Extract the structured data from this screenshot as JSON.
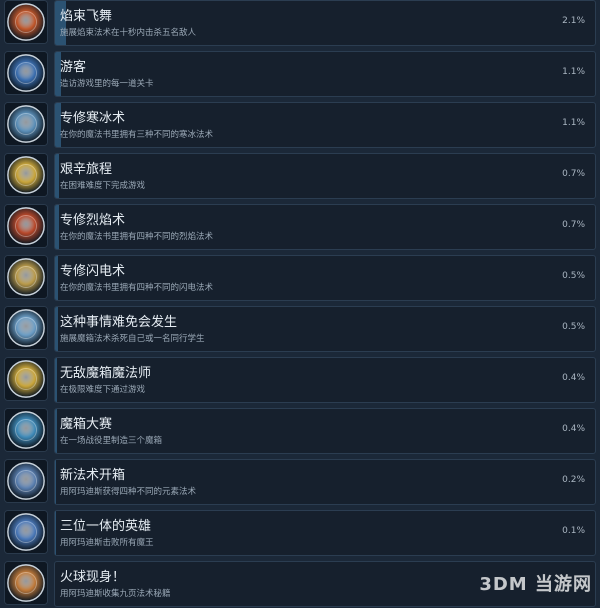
{
  "achievements": [
    {
      "title": "焰束飞舞",
      "desc": "施展焰束法术在十秒内击杀五名敌人",
      "percent_label": "2.1%",
      "percent": 2.1,
      "icon": "flame-streak-icon",
      "color": "#c0562a"
    },
    {
      "title": "游客",
      "desc": "造访游戏里的每一道关卡",
      "percent_label": "1.1%",
      "percent": 1.1,
      "icon": "globe-icon",
      "color": "#3c6fb0"
    },
    {
      "title": "专修寒冰术",
      "desc": "在你的魔法书里拥有三种不同的寒冰法术",
      "percent_label": "1.1%",
      "percent": 1.1,
      "icon": "ice-book-icon",
      "color": "#5b8fb8"
    },
    {
      "title": "艰辛旅程",
      "desc": "在困难难度下完成游戏",
      "percent_label": "0.7%",
      "percent": 0.7,
      "icon": "laurel-crown-icon",
      "color": "#c9a53a"
    },
    {
      "title": "专修烈焰术",
      "desc": "在你的魔法书里拥有四种不同的烈焰法术",
      "percent_label": "0.7%",
      "percent": 0.7,
      "icon": "fire-book-icon",
      "color": "#b8482a"
    },
    {
      "title": "专修闪电术",
      "desc": "在你的魔法书里拥有四种不同的闪电法术",
      "percent_label": "0.5%",
      "percent": 0.5,
      "icon": "lightning-book-icon",
      "color": "#b99a4a"
    },
    {
      "title": "这种事情难免会发生",
      "desc": "施展魔箱法术杀死自己或一名同行学生",
      "percent_label": "0.5%",
      "percent": 0.5,
      "icon": "magic-chest-icon",
      "color": "#6a9cc4"
    },
    {
      "title": "无敌魔箱魔法师",
      "desc": "在极限难度下通过游戏",
      "percent_label": "0.4%",
      "percent": 0.4,
      "icon": "laurel-crown-icon",
      "color": "#c9a53a"
    },
    {
      "title": "魔箱大赛",
      "desc": "在一场战役里制造三个魔箱",
      "percent_label": "0.4%",
      "percent": 0.4,
      "icon": "magic-box-icon",
      "color": "#3f8ab8"
    },
    {
      "title": "新法术开箱",
      "desc": "用阿玛迪斯获得四种不同的元素法术",
      "percent_label": "0.2%",
      "percent": 0.2,
      "icon": "spellbook-icon",
      "color": "#5a7fb0"
    },
    {
      "title": "三位一体的英雄",
      "desc": "用阿玛迪斯击败所有魔王",
      "percent_label": "0.1%",
      "percent": 0.1,
      "icon": "hero-trio-icon",
      "color": "#4a78b8"
    },
    {
      "title": "火球现身！",
      "desc": "用阿玛迪斯收集九页法术秘籍",
      "percent_label": "",
      "percent": 0,
      "icon": "scroll-pile-icon",
      "color": "#c07a3a"
    }
  ],
  "watermark": "3DM 当游网"
}
